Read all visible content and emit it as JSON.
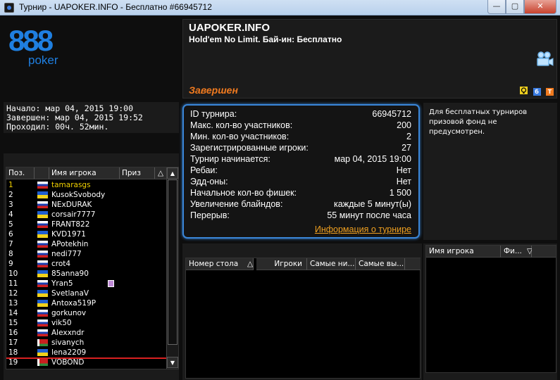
{
  "window": {
    "title": "Турнир - UAPOKER.INFO - Бесплатно #66945712",
    "min_label": "—",
    "max_label": "▢",
    "close_label": "✕"
  },
  "logo": {
    "number": "888",
    "word": "poker"
  },
  "header": {
    "name": "UAPOKER.INFO",
    "subtitle": "Hold'em No Limit. Бай-ин: Бесплатно",
    "status": "Завершен",
    "icons": [
      {
        "name": "camera-icon"
      },
      {
        "name": "trophy-icon",
        "label": "",
        "color": "#f0d020"
      },
      {
        "name": "b-icon",
        "label": "б",
        "color": "#3a7be0"
      },
      {
        "name": "t-icon",
        "label": "Т",
        "color": "#f07a1f"
      }
    ]
  },
  "times": {
    "start": "Начало: мар 04, 2015 19:00",
    "end": "Завершен: мар 04, 2015 19:52",
    "elapsed": "Проходил: 00ч. 52мин."
  },
  "details": [
    {
      "key": "ID турнира:",
      "value": "66945712"
    },
    {
      "key": "Макс. кол-во участников:",
      "value": "200"
    },
    {
      "key": "Мин. кол-во участников:",
      "value": "2"
    },
    {
      "key": "Зарегистрированные игроки:",
      "value": "27"
    },
    {
      "key": "Турнир начинается:",
      "value": "мар 04, 2015 19:00"
    },
    {
      "key": "Ребаи:",
      "value": "Нет"
    },
    {
      "key": "Эдд-оны:",
      "value": "Нет"
    },
    {
      "key": "Начальное кол-во фишек:",
      "value": "1 500"
    },
    {
      "key": "Увеличение блайндов:",
      "value": "каждые 5 минут(ы)"
    },
    {
      "key": "Перерыв:",
      "value": "55 минут после часа"
    }
  ],
  "details_link": "Информация о турнире",
  "prize_note": "Для бесплатных турниров призовой фонд не предусмотрен.",
  "players_table": {
    "columns": {
      "pos": "Поз.",
      "flag": "",
      "name": "Имя игрока",
      "prize": "Приз"
    },
    "rows": [
      {
        "pos": "1",
        "name": "tamarasgs",
        "flag": "ru",
        "highlight": true
      },
      {
        "pos": "2",
        "name": "KusokSvobody",
        "flag": "ua"
      },
      {
        "pos": "3",
        "name": "NExDURAK",
        "flag": "ru"
      },
      {
        "pos": "4",
        "name": "corsair7777",
        "flag": "ua"
      },
      {
        "pos": "5",
        "name": "FRANT822",
        "flag": "ru"
      },
      {
        "pos": "6",
        "name": "KVD1971",
        "flag": "ua"
      },
      {
        "pos": "7",
        "name": "APotekhin",
        "flag": "ru"
      },
      {
        "pos": "8",
        "name": "nedi777",
        "flag": "ru"
      },
      {
        "pos": "9",
        "name": "crot4",
        "flag": "ru"
      },
      {
        "pos": "10",
        "name": "85anna90",
        "flag": "ua"
      },
      {
        "pos": "11",
        "name": "Yran5",
        "flag": "ru",
        "chat": true
      },
      {
        "pos": "12",
        "name": "SvetlanaV",
        "flag": "ua"
      },
      {
        "pos": "13",
        "name": "Antoxa519P",
        "flag": "ua"
      },
      {
        "pos": "14",
        "name": "gorkunov",
        "flag": "ru"
      },
      {
        "pos": "15",
        "name": "vik50",
        "flag": "ru"
      },
      {
        "pos": "16",
        "name": "Alexxndr",
        "flag": "ru"
      },
      {
        "pos": "17",
        "name": "sivanych",
        "flag": "by"
      },
      {
        "pos": "18",
        "name": "lena2209",
        "flag": "ua"
      },
      {
        "pos": "19",
        "name": "VOBOND",
        "flag": "by"
      }
    ]
  },
  "tables_grid": {
    "columns": [
      "Номер стола",
      "Игроки",
      "Самые ни...",
      "Самые вы..."
    ]
  },
  "table_players_grid": {
    "columns": [
      "Имя игрока",
      "Фи..."
    ]
  },
  "colors": {
    "accent_blue": "#3a86d8",
    "status_orange": "#f07a1f",
    "link_orange": "#f0a020",
    "highlight_yellow": "#f0d000",
    "marker_red": "#d92020"
  }
}
